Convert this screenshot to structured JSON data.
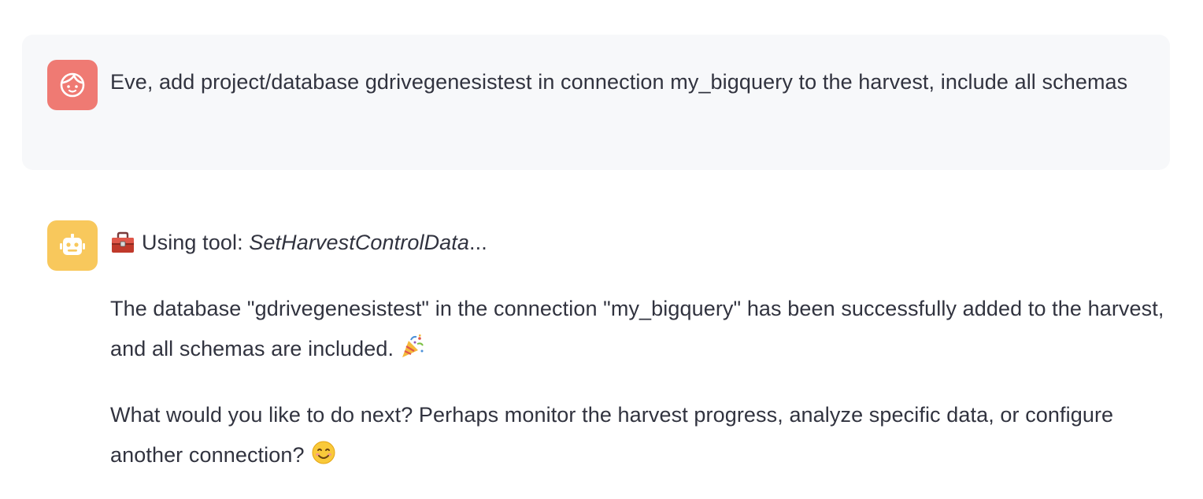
{
  "user_message": {
    "avatar_icon": "user-face-icon",
    "avatar_color": "#ef7a73",
    "text": "Eve, add project/database gdrivegenesistest in connection my_bigquery to the harvest, include all schemas"
  },
  "assistant_message": {
    "avatar_icon": "robot-icon",
    "avatar_color": "#f8c85c",
    "tool_prefix": "Using tool: ",
    "tool_name": "SetHarvestControlData",
    "tool_suffix": "...",
    "tool_icon": "toolbox-icon",
    "paragraph_1": "The database \"gdrivegenesistest\" in the connection \"my_bigquery\" has been successfully added to the harvest, and all schemas are included.",
    "paragraph_1_emoji": "party-popper-icon",
    "paragraph_2": "What would you like to do next? Perhaps monitor the harvest progress, analyze specific data, or configure another connection?",
    "paragraph_2_emoji": "smiling-face-icon"
  }
}
